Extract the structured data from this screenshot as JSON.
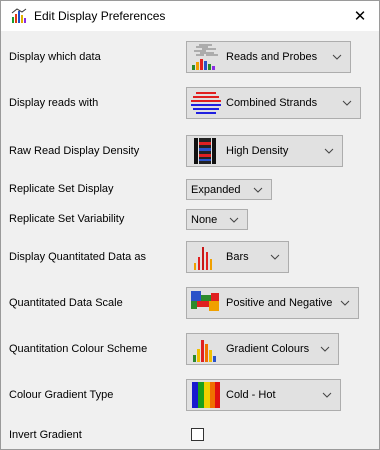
{
  "window": {
    "title": "Edit Display Preferences",
    "close_glyph": "✕"
  },
  "rows": [
    {
      "label": "Display which data",
      "value": "Reads and Probes",
      "icon": "reads-and-probes-icon"
    },
    {
      "label": "Display reads with",
      "value": "Combined Strands",
      "icon": "combined-strands-icon"
    },
    {
      "label": "Raw Read Display Density",
      "value": "High Density",
      "icon": "high-density-icon"
    },
    {
      "label": "Replicate Set Display",
      "value": "Expanded"
    },
    {
      "label": "Replicate Set Variability",
      "value": "None"
    },
    {
      "label": "Display Quantitated Data as",
      "value": "Bars",
      "icon": "bars-icon"
    },
    {
      "label": "Quantitated Data Scale",
      "value": "Positive and Negative",
      "icon": "positive-negative-icon"
    },
    {
      "label": "Quantitation Colour Scheme",
      "value": "Gradient Colours",
      "icon": "gradient-colours-icon"
    },
    {
      "label": "Colour Gradient Type",
      "value": "Cold - Hot",
      "icon": "cold-hot-icon"
    },
    {
      "label": "Invert Gradient",
      "checked": false
    }
  ]
}
